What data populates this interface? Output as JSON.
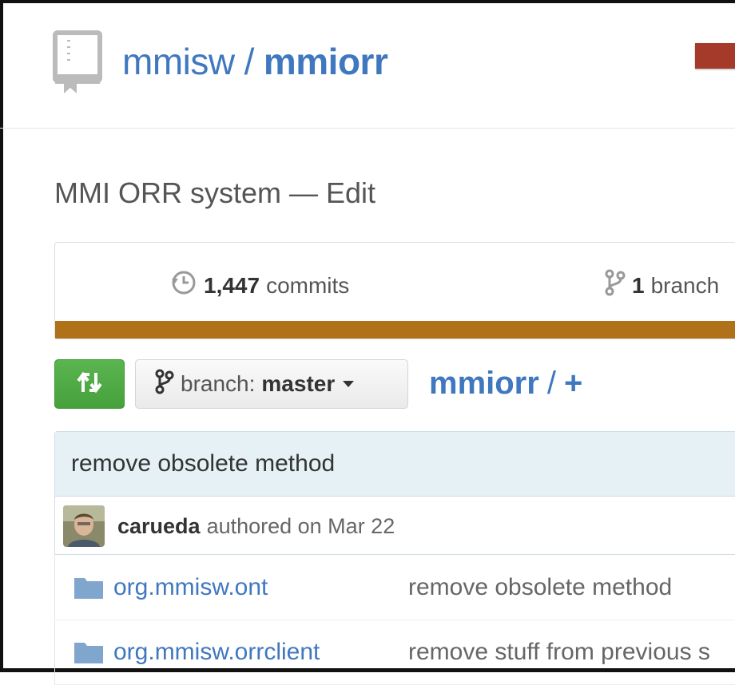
{
  "repo": {
    "owner": "mmisw",
    "separator": "/",
    "name": "mmiorr",
    "icon": "repo-book-icon"
  },
  "description": {
    "text": "MMI ORR system",
    "dash": "—",
    "edit_label": "Edit"
  },
  "stats": {
    "commits_count": "1,447",
    "commits_label": "commits",
    "branches_count": "1",
    "branches_label": "branch"
  },
  "language_bar": {
    "color": "#b07219"
  },
  "toolbar": {
    "compare_icon": "compare-arrows-icon",
    "branch_prefix": "branch:",
    "branch_name": "master",
    "path_root": "mmiorr",
    "path_sep": "/",
    "path_add": "+"
  },
  "latest_commit": {
    "message": "remove obsolete method",
    "author": "carueda",
    "authored_text": "authored on Mar 22"
  },
  "files": [
    {
      "name": "org.mmisw.ont",
      "message": "remove obsolete method"
    },
    {
      "name": "org.mmisw.orrclient",
      "message": "remove stuff from previous s"
    }
  ]
}
